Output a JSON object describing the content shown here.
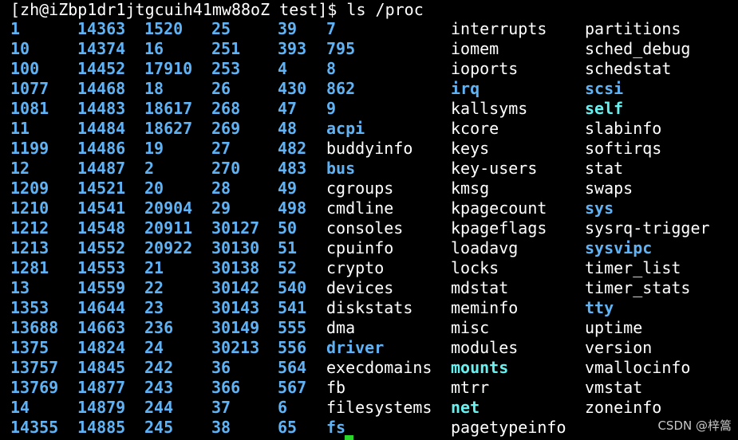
{
  "prompt": "[zh@iZbp1dr1jtgcuih41mw88oZ test]$ ls /proc",
  "watermark": "CSDN @梓篙",
  "colors": {
    "background": "#000000",
    "text": "#ffffff",
    "directory": "#5fb3f5",
    "symlink": "#66f0f0",
    "cursor": "#2ad62a"
  },
  "rows": [
    [
      [
        "1",
        "d"
      ],
      [
        "14363",
        "d"
      ],
      [
        "1520",
        "d"
      ],
      [
        "25",
        "d"
      ],
      [
        "39",
        "d"
      ],
      [
        "7",
        "d"
      ],
      [
        "interrupts",
        "f"
      ],
      [
        "partitions",
        "f"
      ]
    ],
    [
      [
        "10",
        "d"
      ],
      [
        "14374",
        "d"
      ],
      [
        "16",
        "d"
      ],
      [
        "251",
        "d"
      ],
      [
        "393",
        "d"
      ],
      [
        "795",
        "d"
      ],
      [
        "iomem",
        "f"
      ],
      [
        "sched_debug",
        "f"
      ]
    ],
    [
      [
        "100",
        "d"
      ],
      [
        "14452",
        "d"
      ],
      [
        "17910",
        "d"
      ],
      [
        "253",
        "d"
      ],
      [
        "4",
        "d"
      ],
      [
        "8",
        "d"
      ],
      [
        "ioports",
        "f"
      ],
      [
        "schedstat",
        "f"
      ]
    ],
    [
      [
        "1077",
        "d"
      ],
      [
        "14468",
        "d"
      ],
      [
        "18",
        "d"
      ],
      [
        "26",
        "d"
      ],
      [
        "430",
        "d"
      ],
      [
        "862",
        "d"
      ],
      [
        "irq",
        "d"
      ],
      [
        "scsi",
        "d"
      ]
    ],
    [
      [
        "1081",
        "d"
      ],
      [
        "14483",
        "d"
      ],
      [
        "18617",
        "d"
      ],
      [
        "268",
        "d"
      ],
      [
        "47",
        "d"
      ],
      [
        "9",
        "d"
      ],
      [
        "kallsyms",
        "f"
      ],
      [
        "self",
        "l"
      ]
    ],
    [
      [
        "11",
        "d"
      ],
      [
        "14484",
        "d"
      ],
      [
        "18627",
        "d"
      ],
      [
        "269",
        "d"
      ],
      [
        "48",
        "d"
      ],
      [
        "acpi",
        "d"
      ],
      [
        "kcore",
        "f"
      ],
      [
        "slabinfo",
        "f"
      ]
    ],
    [
      [
        "1199",
        "d"
      ],
      [
        "14486",
        "d"
      ],
      [
        "19",
        "d"
      ],
      [
        "27",
        "d"
      ],
      [
        "482",
        "d"
      ],
      [
        "buddyinfo",
        "f"
      ],
      [
        "keys",
        "f"
      ],
      [
        "softirqs",
        "f"
      ]
    ],
    [
      [
        "12",
        "d"
      ],
      [
        "14487",
        "d"
      ],
      [
        "2",
        "d"
      ],
      [
        "270",
        "d"
      ],
      [
        "483",
        "d"
      ],
      [
        "bus",
        "d"
      ],
      [
        "key-users",
        "f"
      ],
      [
        "stat",
        "f"
      ]
    ],
    [
      [
        "1209",
        "d"
      ],
      [
        "14521",
        "d"
      ],
      [
        "20",
        "d"
      ],
      [
        "28",
        "d"
      ],
      [
        "49",
        "d"
      ],
      [
        "cgroups",
        "f"
      ],
      [
        "kmsg",
        "f"
      ],
      [
        "swaps",
        "f"
      ]
    ],
    [
      [
        "1210",
        "d"
      ],
      [
        "14541",
        "d"
      ],
      [
        "20904",
        "d"
      ],
      [
        "29",
        "d"
      ],
      [
        "498",
        "d"
      ],
      [
        "cmdline",
        "f"
      ],
      [
        "kpagecount",
        "f"
      ],
      [
        "sys",
        "d"
      ]
    ],
    [
      [
        "1212",
        "d"
      ],
      [
        "14548",
        "d"
      ],
      [
        "20911",
        "d"
      ],
      [
        "30127",
        "d"
      ],
      [
        "50",
        "d"
      ],
      [
        "consoles",
        "f"
      ],
      [
        "kpageflags",
        "f"
      ],
      [
        "sysrq-trigger",
        "f"
      ]
    ],
    [
      [
        "1213",
        "d"
      ],
      [
        "14552",
        "d"
      ],
      [
        "20922",
        "d"
      ],
      [
        "30130",
        "d"
      ],
      [
        "51",
        "d"
      ],
      [
        "cpuinfo",
        "f"
      ],
      [
        "loadavg",
        "f"
      ],
      [
        "sysvipc",
        "d"
      ]
    ],
    [
      [
        "1281",
        "d"
      ],
      [
        "14553",
        "d"
      ],
      [
        "21",
        "d"
      ],
      [
        "30138",
        "d"
      ],
      [
        "52",
        "d"
      ],
      [
        "crypto",
        "f"
      ],
      [
        "locks",
        "f"
      ],
      [
        "timer_list",
        "f"
      ]
    ],
    [
      [
        "13",
        "d"
      ],
      [
        "14559",
        "d"
      ],
      [
        "22",
        "d"
      ],
      [
        "30142",
        "d"
      ],
      [
        "540",
        "d"
      ],
      [
        "devices",
        "f"
      ],
      [
        "mdstat",
        "f"
      ],
      [
        "timer_stats",
        "f"
      ]
    ],
    [
      [
        "1353",
        "d"
      ],
      [
        "14644",
        "d"
      ],
      [
        "23",
        "d"
      ],
      [
        "30143",
        "d"
      ],
      [
        "541",
        "d"
      ],
      [
        "diskstats",
        "f"
      ],
      [
        "meminfo",
        "f"
      ],
      [
        "tty",
        "d"
      ]
    ],
    [
      [
        "13688",
        "d"
      ],
      [
        "14663",
        "d"
      ],
      [
        "236",
        "d"
      ],
      [
        "30149",
        "d"
      ],
      [
        "555",
        "d"
      ],
      [
        "dma",
        "f"
      ],
      [
        "misc",
        "f"
      ],
      [
        "uptime",
        "f"
      ]
    ],
    [
      [
        "1375",
        "d"
      ],
      [
        "14824",
        "d"
      ],
      [
        "24",
        "d"
      ],
      [
        "30213",
        "d"
      ],
      [
        "556",
        "d"
      ],
      [
        "driver",
        "d"
      ],
      [
        "modules",
        "f"
      ],
      [
        "version",
        "f"
      ]
    ],
    [
      [
        "13757",
        "d"
      ],
      [
        "14845",
        "d"
      ],
      [
        "242",
        "d"
      ],
      [
        "36",
        "d"
      ],
      [
        "564",
        "d"
      ],
      [
        "execdomains",
        "f"
      ],
      [
        "mounts",
        "l"
      ],
      [
        "vmallocinfo",
        "f"
      ]
    ],
    [
      [
        "13769",
        "d"
      ],
      [
        "14877",
        "d"
      ],
      [
        "243",
        "d"
      ],
      [
        "366",
        "d"
      ],
      [
        "567",
        "d"
      ],
      [
        "fb",
        "f"
      ],
      [
        "mtrr",
        "f"
      ],
      [
        "vmstat",
        "f"
      ]
    ],
    [
      [
        "14",
        "d"
      ],
      [
        "14879",
        "d"
      ],
      [
        "244",
        "d"
      ],
      [
        "37",
        "d"
      ],
      [
        "6",
        "d"
      ],
      [
        "filesystems",
        "f"
      ],
      [
        "net",
        "l"
      ],
      [
        "zoneinfo",
        "f"
      ]
    ],
    [
      [
        "14355",
        "d"
      ],
      [
        "14885",
        "d"
      ],
      [
        "245",
        "d"
      ],
      [
        "38",
        "d"
      ],
      [
        "65",
        "d"
      ],
      [
        "fs",
        "d"
      ],
      [
        "pagetypeinfo",
        "f"
      ],
      [
        "",
        "f"
      ]
    ]
  ]
}
